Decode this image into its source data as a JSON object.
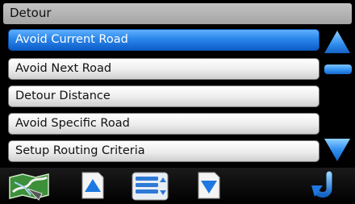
{
  "header": {
    "title": "Detour"
  },
  "menu": {
    "items": [
      {
        "label": "Avoid Current Road",
        "selected": true
      },
      {
        "label": "Avoid Next Road",
        "selected": false
      },
      {
        "label": "Detour Distance",
        "selected": false
      },
      {
        "label": "Avoid Specific Road",
        "selected": false
      },
      {
        "label": "Setup Routing Criteria",
        "selected": false
      }
    ]
  },
  "scrollbar": {
    "up_icon": "triangle-up-icon",
    "down_icon": "triangle-down-icon"
  },
  "toolbar": {
    "map_icon": "map-icon",
    "page_up_icon": "page-up-icon",
    "list_icon": "list-icon",
    "page_down_icon": "page-down-icon",
    "back_icon": "back-arrow-icon"
  },
  "colors": {
    "accent": "#1f7ae0",
    "title_bar": "#b4b4b4",
    "item_background": "#ececec",
    "background": "#000000"
  }
}
